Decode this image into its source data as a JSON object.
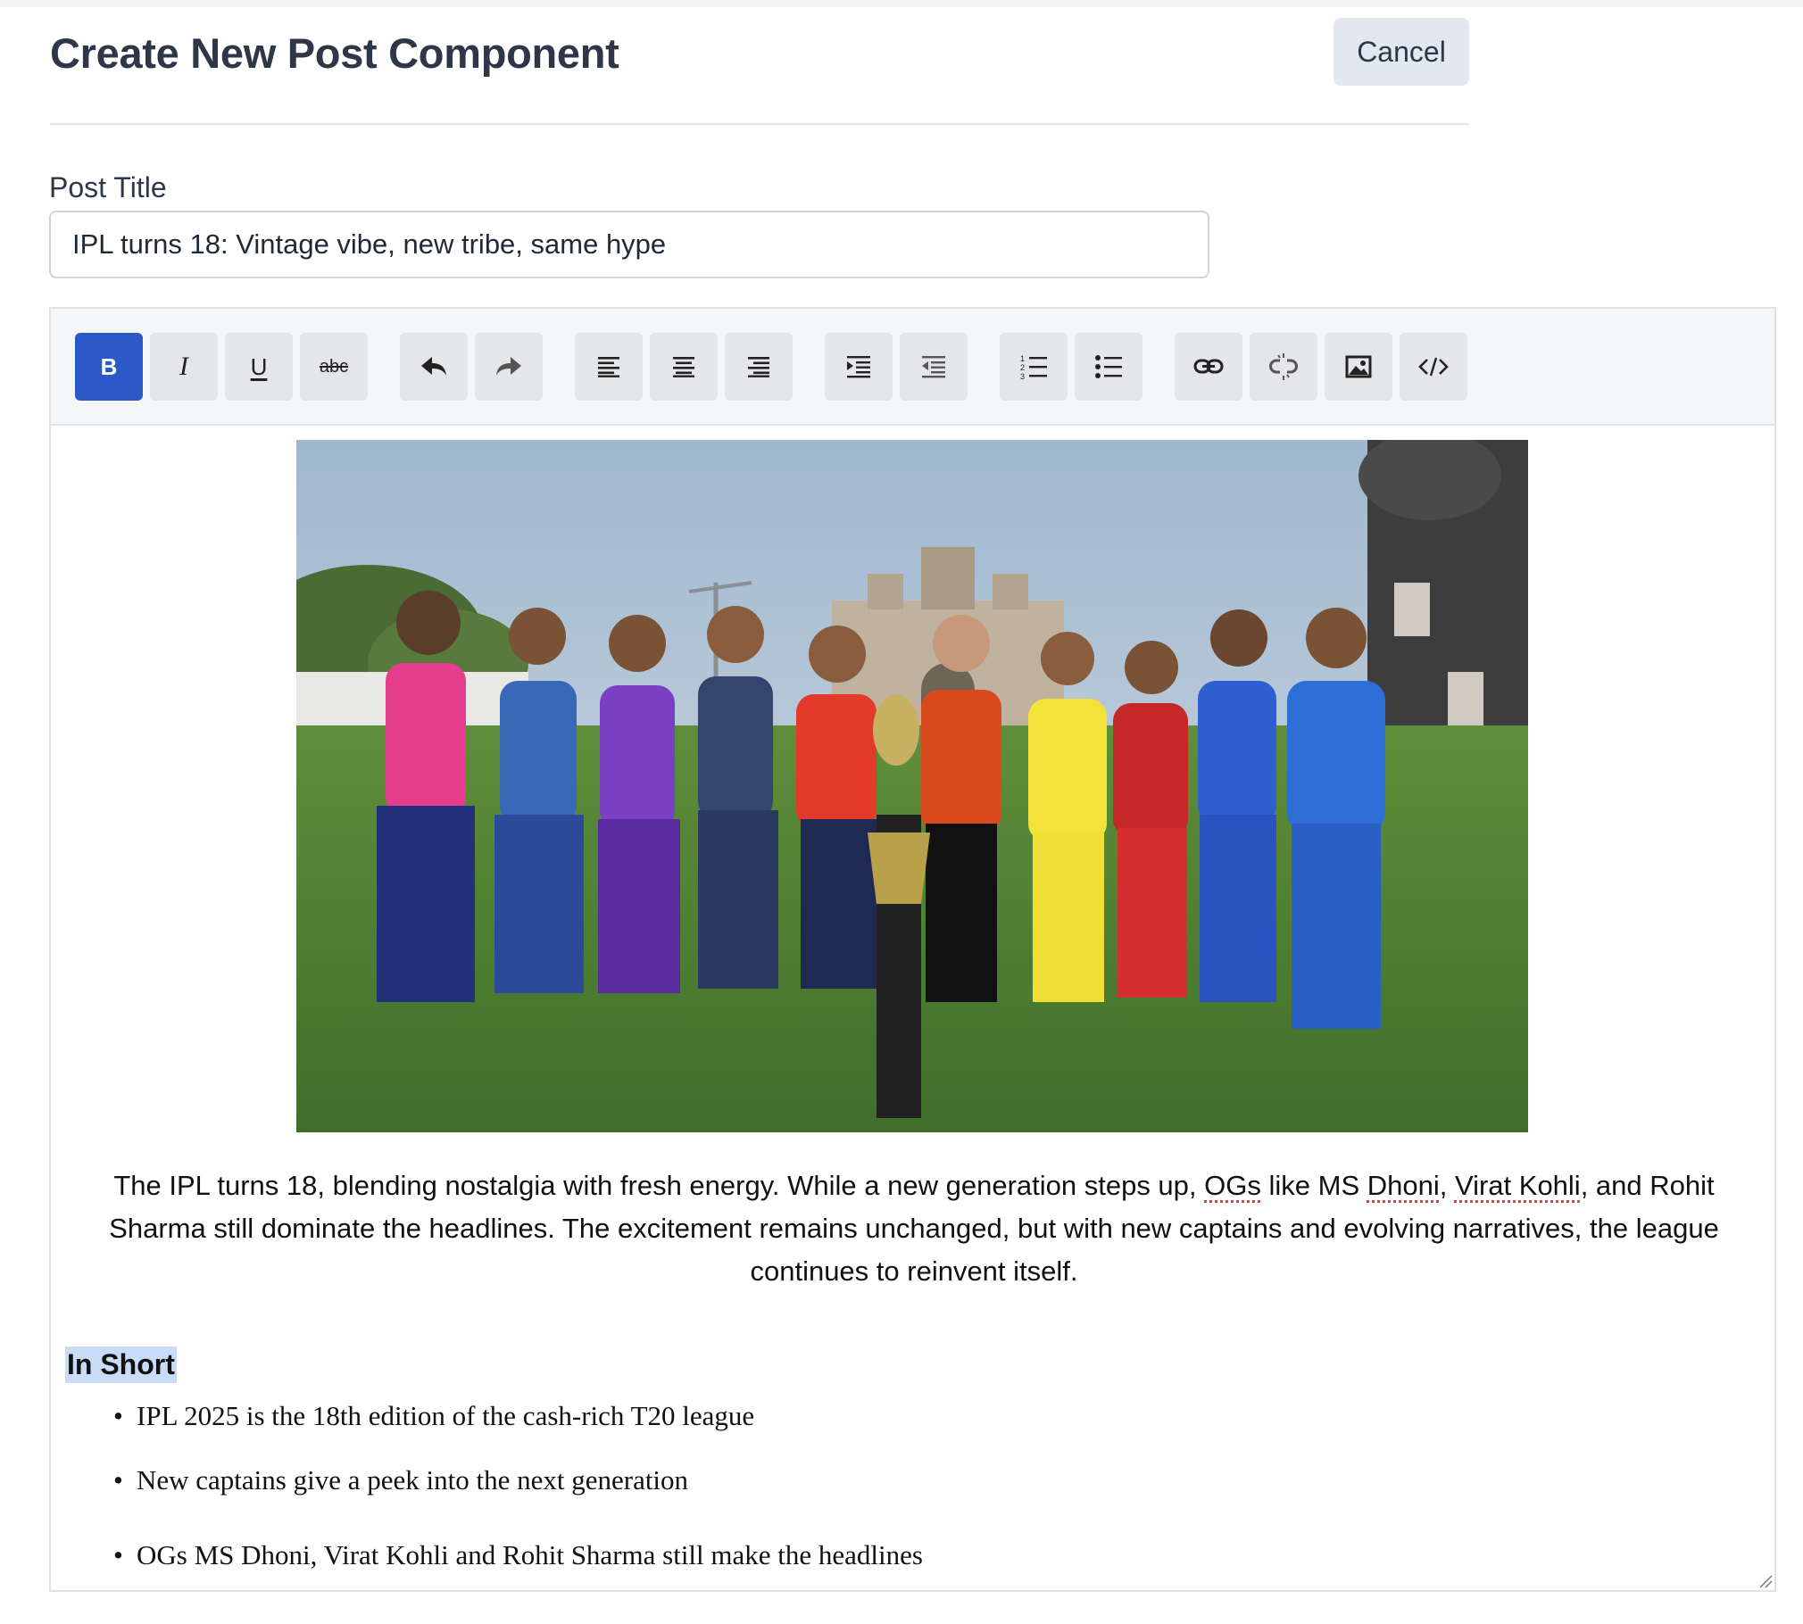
{
  "page": {
    "title": "Create New Post Component",
    "cancel_label": "Cancel"
  },
  "form": {
    "title_label": "Post Title",
    "title_value": "IPL turns 18: Vintage vibe, new tribe, same hype"
  },
  "toolbar": {
    "buttons": [
      {
        "name": "bold-button",
        "icon": "bold-icon",
        "label": "B",
        "active": true
      },
      {
        "name": "italic-button",
        "icon": "italic-icon",
        "label": "I"
      },
      {
        "name": "underline-button",
        "icon": "underline-icon",
        "label": "U"
      },
      {
        "name": "strikethrough-button",
        "icon": "strikethrough-icon",
        "label": "abc"
      },
      {
        "name": "undo-button",
        "icon": "undo-icon"
      },
      {
        "name": "redo-button",
        "icon": "redo-icon"
      },
      {
        "name": "align-left-button",
        "icon": "align-left-icon"
      },
      {
        "name": "align-center-button",
        "icon": "align-center-icon"
      },
      {
        "name": "align-right-button",
        "icon": "align-right-icon"
      },
      {
        "name": "indent-button",
        "icon": "indent-icon"
      },
      {
        "name": "outdent-button",
        "icon": "outdent-icon"
      },
      {
        "name": "ordered-list-button",
        "icon": "ordered-list-icon"
      },
      {
        "name": "bullet-list-button",
        "icon": "bullet-list-icon"
      },
      {
        "name": "link-button",
        "icon": "link-icon"
      },
      {
        "name": "unlink-button",
        "icon": "unlink-icon"
      },
      {
        "name": "image-button",
        "icon": "image-icon"
      },
      {
        "name": "code-view-button",
        "icon": "code-icon"
      }
    ]
  },
  "editor": {
    "caption_parts": {
      "p1": "The IPL turns 18, blending nostalgia with fresh energy. While a new generation steps up, ",
      "og": "OGs",
      "p2": " like MS ",
      "dhoni": "Dhoni",
      "p3": ", ",
      "virat_kohli": "Virat Kohli",
      "p4": ", and Rohit Sharma still dominate the headlines. The excitement remains unchanged, but with new captains and evolving narratives, the league continues to reinvent itself."
    },
    "section_heading": "In Short",
    "bullets": [
      "IPL 2025 is the 18th edition of the cash-rich T20 league",
      "New captains give a peek into the next generation",
      "OGs MS Dhoni, Virat Kohli and Rohit Sharma still make the headlines"
    ],
    "colors": {
      "active_button": "#2a58c7",
      "selection_highlight": "#c8dcf7",
      "spellcheck": "#e53e3e"
    }
  }
}
